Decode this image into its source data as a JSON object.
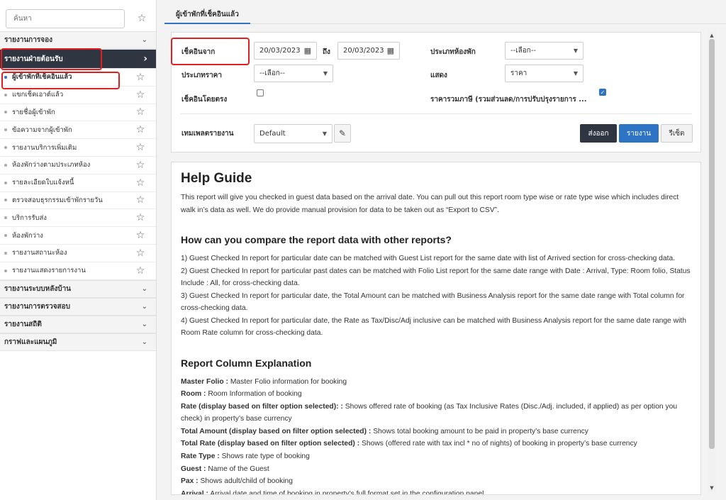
{
  "sidebar": {
    "search_placeholder": "ค้นหา",
    "sections_top": [
      {
        "label": "รายงานการจอง"
      }
    ],
    "active_section": {
      "label": "รายงานฝ่ายต้อนรับ"
    },
    "items": [
      {
        "label": "ผู้เข้าพักที่เช็คอินแล้ว"
      },
      {
        "label": "แขกเช็คเอาต์แล้ว"
      },
      {
        "label": "รายชื่อผู้เข้าพัก"
      },
      {
        "label": "ข้อความจากผู้เข้าพัก"
      },
      {
        "label": "รายงานบริการเพิ่มเติม"
      },
      {
        "label": "ห้องพักว่างตามประเภทห้อง"
      },
      {
        "label": "รายละเอียดใบแจ้งหนี้"
      },
      {
        "label": "ตรวจสอบธุรกรรมเข้าพักรายวัน"
      },
      {
        "label": "บริการรับส่ง"
      },
      {
        "label": "ห้องพักว่าง"
      },
      {
        "label": "รายงานสถานะห้อง"
      },
      {
        "label": "รายงานแสดงรายการงาน"
      }
    ],
    "sections_bottom": [
      {
        "label": "รายงานระบบหลังบ้าน"
      },
      {
        "label": "รายงานการตรวจสอบ"
      },
      {
        "label": "รายงานสถิติ"
      },
      {
        "label": "กราฟและแผนภูมิ"
      }
    ]
  },
  "tab": {
    "label": "ผู้เข้าพักที่เช็คอินแล้ว"
  },
  "filters": {
    "checkin_from_label": "เช็คอินจาก",
    "date_from": "20/03/2023",
    "to_label": "ถึง",
    "date_to": "20/03/2023",
    "room_type_label": "ประเภทห้องพัก",
    "room_type_value": "--เลือก--",
    "rate_type_label": "ประเภทราคา",
    "rate_type_value": "--เลือก--",
    "display_label": "แสดง",
    "display_value": "ราคา",
    "direct_checkin_label": "เช็คอินโดยตรง",
    "rate_inclusive_label": "ราคารวมภาษี (รวมส่วนลด/การปรับปรุงรายการ ...",
    "template_label": "เทมเพลตรายงาน",
    "template_value": "Default",
    "export_label": "ส่งออก",
    "report_label": "รายงาน",
    "reset_label": "รีเซ็ต"
  },
  "help": {
    "title": "Help Guide",
    "intro": "This report will give you checked in guest data based on the arrival date. You can pull out this report room type wise or rate type wise which includes direct walk in’s data as well. We do provide manual provision for data to be taken out as “Export to CSV”.",
    "compare_title": "How can you compare the report data with other reports?",
    "compare_1": "1) Guest Checked In report for particular date can be matched with Guest List report for the same date with list of Arrived section for cross-checking data.",
    "compare_2": "2) Guest Checked In report for particular past dates can be matched with Folio List report for the same date range with Date : Arrival, Type: Room folio, Status Include : All, for cross-checking data.",
    "compare_3": "3) Guest Checked In report for particular date, the Total Amount can be matched with Business Analysis report for the same date range with Total column for cross-checking data.",
    "compare_4": "4) Guest Checked In report for particular date, the Rate as Tax/Disc/Adj inclusive can be matched with Business Analysis report for the same date range with Room Rate column for cross-checking data.",
    "columns_title": "Report Column Explanation",
    "columns": [
      {
        "name": "Master Folio :",
        "desc": "Master Folio information for booking"
      },
      {
        "name": "Room :",
        "desc": "Room Information of booking"
      },
      {
        "name": "Rate (display based on filter option selected): :",
        "desc": "Shows offered rate of booking (as Tax Inclusive Rates (Disc./Adj. included, if applied) as per option you check) in property’s base currency"
      },
      {
        "name": "Total Amount (display based on filter option selected) :",
        "desc": "Shows total booking amount to be paid in property’s base currency"
      },
      {
        "name": "Total Rate (display based on filter option selected) :",
        "desc": "Shows (offered rate with tax incl * no of nights) of booking in property’s base currency"
      },
      {
        "name": "Rate Type :",
        "desc": "Shows rate type of booking"
      },
      {
        "name": "Guest :",
        "desc": "Name of the Guest"
      },
      {
        "name": "Pax :",
        "desc": "Shows adult/child of booking"
      },
      {
        "name": "Arrival :",
        "desc": "Arrival date and time of booking in property’s full format set in the configuration panel"
      }
    ]
  }
}
